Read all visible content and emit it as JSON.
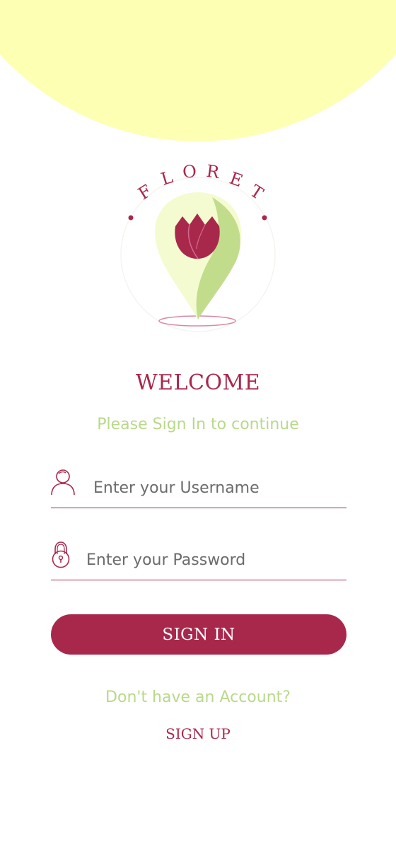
{
  "colors": {
    "brand": "#a8284c",
    "accent_green": "#b8d98a",
    "top_blob": "#fdffb3"
  },
  "logo": {
    "brand_name": "FLORET",
    "letters": [
      "F",
      "L",
      "O",
      "R",
      "E",
      "T"
    ]
  },
  "welcome": {
    "title": "WELCOME",
    "subtitle": "Please Sign In to continue"
  },
  "form": {
    "username": {
      "icon": "user-icon",
      "placeholder": "Enter your Username",
      "value": ""
    },
    "password": {
      "icon": "lock-icon",
      "placeholder": "Enter your Password",
      "value": ""
    },
    "signin_label": "SIGN IN"
  },
  "footer": {
    "prompt": "Don't have an Account?",
    "signup_label": "SIGN UP"
  }
}
